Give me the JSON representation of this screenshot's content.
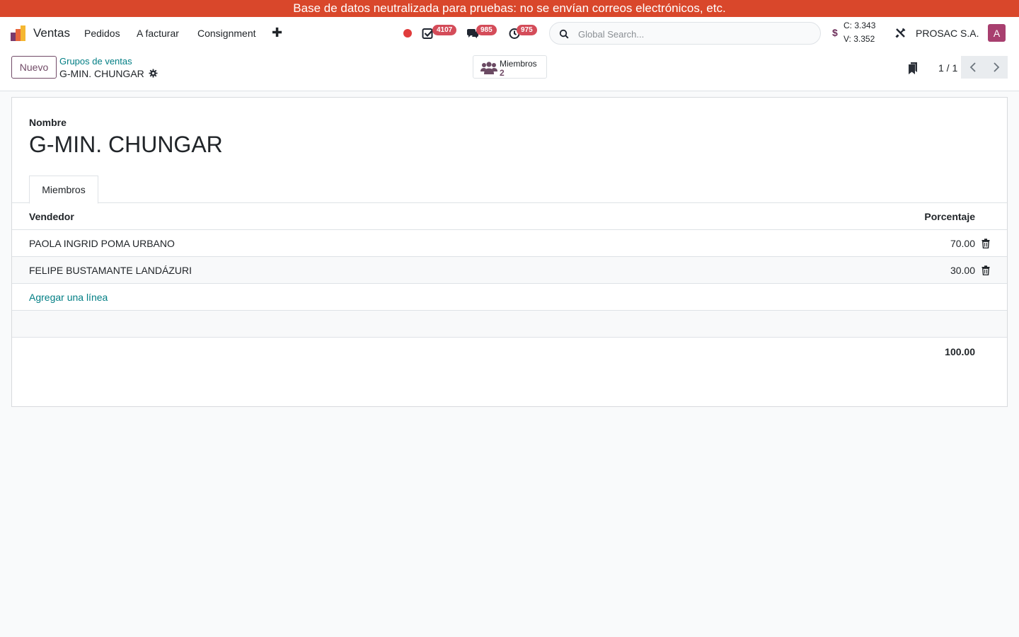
{
  "banner": {
    "text": "Base de datos neutralizada para pruebas: no se envían correos electrónicos, etc."
  },
  "navbar": {
    "app_name": "Ventas",
    "menu": [
      "Pedidos",
      "A facturar",
      "Consignment"
    ],
    "activities_count": "4107",
    "messages_count": "985",
    "timers_count": "975",
    "search_placeholder": "Global Search...",
    "rate_buy": "C: 3.343",
    "rate_sell": "V: 3.352",
    "company": "PROSAC S.A.",
    "avatar_letter": "A",
    "colors": {
      "accent": "#714b67",
      "banner": "#d9472b",
      "badge": "#d44c59",
      "link": "#017e84"
    }
  },
  "control": {
    "new_label": "Nuevo",
    "breadcrumb_parent": "Grupos de ventas",
    "breadcrumb_current": "G-MIN. CHUNGAR",
    "members_label": "Miembros",
    "members_count": "2",
    "pager": "1 / 1"
  },
  "form": {
    "name_label": "Nombre",
    "name_value": "G-MIN. CHUNGAR",
    "tab_label": "Miembros",
    "columns": {
      "seller": "Vendedor",
      "percentage": "Porcentaje"
    },
    "rows": [
      {
        "seller": "PAOLA INGRID POMA URBANO",
        "percentage": "70.00"
      },
      {
        "seller": "FELIPE BUSTAMANTE LANDÁZURI",
        "percentage": "30.00"
      }
    ],
    "add_line": "Agregar una línea",
    "total": "100.00"
  }
}
